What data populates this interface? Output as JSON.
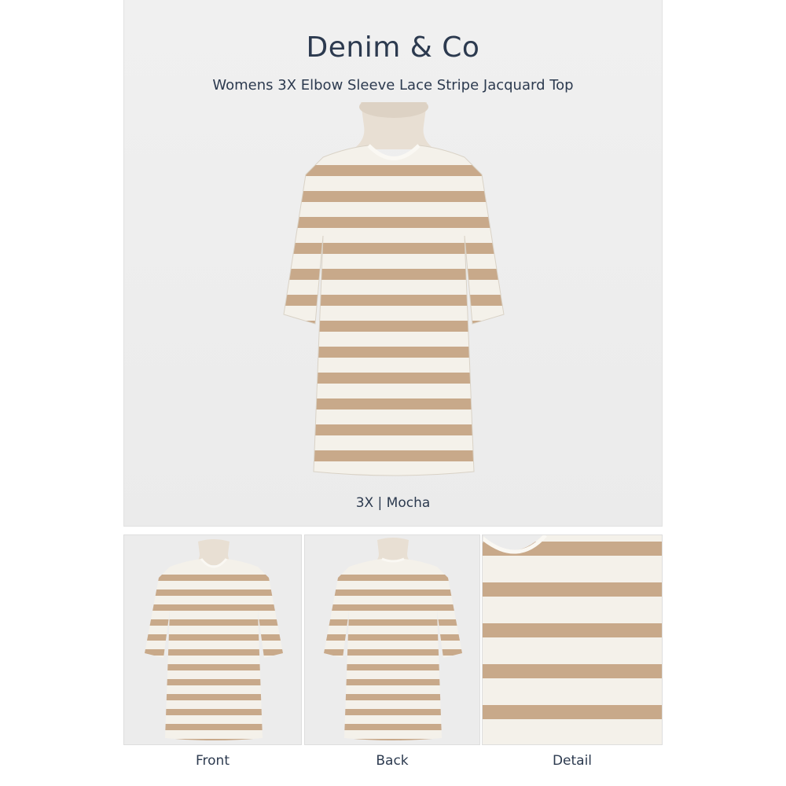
{
  "header": {
    "brand": "Denim & Co",
    "product_title": "Womens 3X Elbow Sleeve Lace Stripe Jacquard Top"
  },
  "variant": {
    "label": "3X | Mocha"
  },
  "gallery": {
    "front_label": "Front",
    "back_label": "Back",
    "detail_label": "Detail"
  },
  "colors": {
    "stripe": "#c8a98a",
    "base": "#f4f1ea",
    "text": "#2c3a4f",
    "mannequin": "#e8dfd3"
  }
}
